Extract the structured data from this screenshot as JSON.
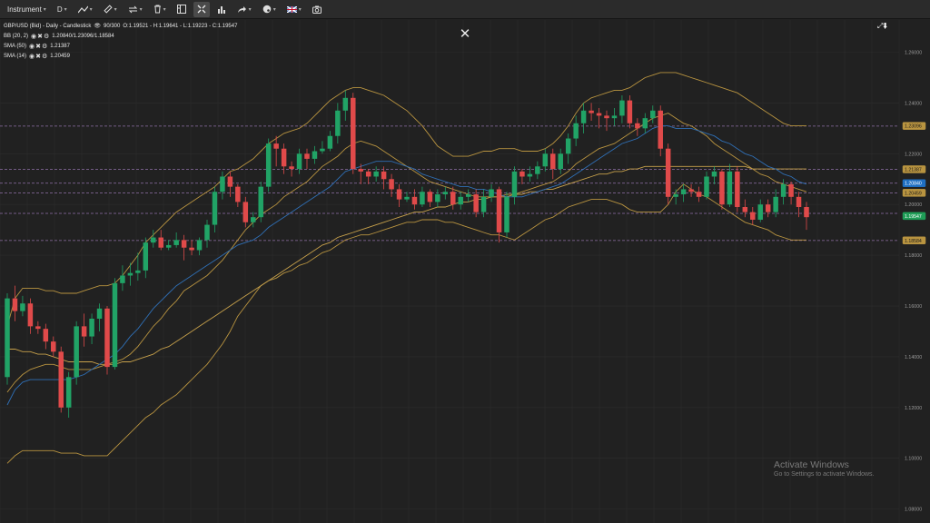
{
  "toolbar": {
    "instrument_label": "Instrument",
    "timeframe_label": "D",
    "flag_icon": "uk-flag-icon"
  },
  "legend": {
    "title_line": "GBP/USD (Bid) - Daily - Candlestick",
    "bars_info": "90/300",
    "ohlc": "O:1.19521 - H:1.19641 - L:1.19223 - C:1.19547",
    "indicators": [
      {
        "name": "BB (20, 2)",
        "values": "1.20840/1.23096/1.18584"
      },
      {
        "name": "SMA (50)",
        "values": "1.21387"
      },
      {
        "name": "SMA (14)",
        "values": "1.20459"
      }
    ]
  },
  "close_icon_glyph": "✕",
  "expand_icon_glyph": "⤢⬇",
  "colors": {
    "background": "#212121",
    "grid": "#2c2c2c",
    "bull": "#21a366",
    "bear": "#e04a4a",
    "bollinger": "#b99440",
    "sma50": "#c7a14b",
    "sma14": "#2f6fb5",
    "level_line": "#b58ad6",
    "tag_blue": "#1f6fc2",
    "tag_green": "#1f9d57"
  },
  "chart_data": {
    "type": "candlestick",
    "y_ticks": [
      "1.26000",
      "1.24000",
      "1.22000",
      "1.20000",
      "1.18000",
      "1.16000",
      "1.14000",
      "1.12000",
      "1.10000",
      "1.08000"
    ],
    "ylim": [
      1.0745,
      1.2727
    ],
    "level_lines": [
      1.2309,
      1.2139,
      1.2084,
      1.2046,
      1.1965,
      1.1858
    ],
    "price_tags": [
      {
        "text": "1.23096",
        "value": 1.23096,
        "style": "bb"
      },
      {
        "text": "1.21387",
        "value": 1.21387,
        "style": "bb"
      },
      {
        "text": "1.20840",
        "value": 1.2084,
        "style": "blue"
      },
      {
        "text": "1.20459",
        "value": 1.20459,
        "style": "bb"
      },
      {
        "text": "1.19547",
        "value": 1.19547,
        "style": "green"
      },
      {
        "text": "1.18584",
        "value": 1.18584,
        "style": "bb"
      }
    ],
    "candles": [
      [
        1.132,
        1.163,
        1.129,
        1.165
      ],
      [
        1.163,
        1.158,
        1.154,
        1.168
      ],
      [
        1.158,
        1.161,
        1.156,
        1.164
      ],
      [
        1.161,
        1.152,
        1.149,
        1.163
      ],
      [
        1.152,
        1.151,
        1.149,
        1.154
      ],
      [
        1.151,
        1.146,
        1.143,
        1.153
      ],
      [
        1.146,
        1.142,
        1.14,
        1.148
      ],
      [
        1.142,
        1.12,
        1.118,
        1.144
      ],
      [
        1.12,
        1.132,
        1.116,
        1.134
      ],
      [
        1.132,
        1.152,
        1.129,
        1.154
      ],
      [
        1.152,
        1.148,
        1.144,
        1.157
      ],
      [
        1.148,
        1.155,
        1.145,
        1.157
      ],
      [
        1.155,
        1.159,
        1.15,
        1.161
      ],
      [
        1.159,
        1.136,
        1.133,
        1.16
      ],
      [
        1.136,
        1.169,
        1.135,
        1.171
      ],
      [
        1.169,
        1.172,
        1.166,
        1.176
      ],
      [
        1.172,
        1.173,
        1.168,
        1.177
      ],
      [
        1.173,
        1.174,
        1.17,
        1.181
      ],
      [
        1.174,
        1.185,
        1.171,
        1.187
      ],
      [
        1.185,
        1.187,
        1.183,
        1.19
      ],
      [
        1.187,
        1.183,
        1.182,
        1.19
      ],
      [
        1.183,
        1.184,
        1.182,
        1.186
      ],
      [
        1.184,
        1.186,
        1.183,
        1.189
      ],
      [
        1.186,
        1.183,
        1.178,
        1.188
      ],
      [
        1.183,
        1.182,
        1.18,
        1.186
      ],
      [
        1.182,
        1.186,
        1.18,
        1.187
      ],
      [
        1.186,
        1.192,
        1.183,
        1.194
      ],
      [
        1.192,
        1.205,
        1.189,
        1.207
      ],
      [
        1.205,
        1.211,
        1.202,
        1.213
      ],
      [
        1.211,
        1.207,
        1.203,
        1.213
      ],
      [
        1.207,
        1.201,
        1.199,
        1.208
      ],
      [
        1.201,
        1.193,
        1.191,
        1.203
      ],
      [
        1.193,
        1.195,
        1.191,
        1.197
      ],
      [
        1.195,
        1.207,
        1.193,
        1.209
      ],
      [
        1.207,
        1.224,
        1.205,
        1.226
      ],
      [
        1.224,
        1.222,
        1.215,
        1.227
      ],
      [
        1.222,
        1.215,
        1.212,
        1.224
      ],
      [
        1.215,
        1.214,
        1.211,
        1.217
      ],
      [
        1.214,
        1.22,
        1.212,
        1.222
      ],
      [
        1.22,
        1.218,
        1.214,
        1.222
      ],
      [
        1.218,
        1.221,
        1.216,
        1.223
      ],
      [
        1.221,
        1.222,
        1.22,
        1.225
      ],
      [
        1.222,
        1.227,
        1.221,
        1.229
      ],
      [
        1.227,
        1.237,
        1.224,
        1.24
      ],
      [
        1.237,
        1.242,
        1.233,
        1.245
      ],
      [
        1.242,
        1.214,
        1.212,
        1.244
      ],
      [
        1.214,
        1.213,
        1.208,
        1.216
      ],
      [
        1.213,
        1.211,
        1.208,
        1.214
      ],
      [
        1.211,
        1.213,
        1.209,
        1.215
      ],
      [
        1.213,
        1.21,
        1.206,
        1.215
      ],
      [
        1.21,
        1.206,
        1.203,
        1.212
      ],
      [
        1.206,
        1.202,
        1.199,
        1.208
      ],
      [
        1.202,
        1.203,
        1.201,
        1.205
      ],
      [
        1.203,
        1.2,
        1.198,
        1.206
      ],
      [
        1.2,
        1.205,
        1.199,
        1.207
      ],
      [
        1.205,
        1.201,
        1.199,
        1.206
      ],
      [
        1.201,
        1.204,
        1.199,
        1.206
      ],
      [
        1.204,
        1.205,
        1.202,
        1.207
      ],
      [
        1.205,
        1.2,
        1.198,
        1.207
      ],
      [
        1.2,
        1.203,
        1.198,
        1.205
      ],
      [
        1.203,
        1.204,
        1.201,
        1.206
      ],
      [
        1.204,
        1.197,
        1.195,
        1.206
      ],
      [
        1.197,
        1.203,
        1.195,
        1.206
      ],
      [
        1.203,
        1.206,
        1.201,
        1.208
      ],
      [
        1.206,
        1.189,
        1.185,
        1.207
      ],
      [
        1.189,
        1.203,
        1.187,
        1.205
      ],
      [
        1.203,
        1.213,
        1.2,
        1.215
      ],
      [
        1.213,
        1.211,
        1.208,
        1.214
      ],
      [
        1.211,
        1.212,
        1.209,
        1.215
      ],
      [
        1.212,
        1.215,
        1.21,
        1.217
      ],
      [
        1.215,
        1.22,
        1.213,
        1.222
      ],
      [
        1.22,
        1.214,
        1.21,
        1.222
      ],
      [
        1.214,
        1.22,
        1.212,
        1.222
      ],
      [
        1.22,
        1.226,
        1.216,
        1.228
      ],
      [
        1.226,
        1.232,
        1.223,
        1.235
      ],
      [
        1.232,
        1.237,
        1.228,
        1.24
      ],
      [
        1.237,
        1.236,
        1.233,
        1.24
      ],
      [
        1.236,
        1.235,
        1.23,
        1.238
      ],
      [
        1.235,
        1.234,
        1.229,
        1.237
      ],
      [
        1.234,
        1.235,
        1.231,
        1.238
      ],
      [
        1.235,
        1.241,
        1.232,
        1.243
      ],
      [
        1.241,
        1.232,
        1.23,
        1.243
      ],
      [
        1.232,
        1.23,
        1.227,
        1.234
      ],
      [
        1.23,
        1.234,
        1.228,
        1.236
      ],
      [
        1.234,
        1.237,
        1.232,
        1.239
      ],
      [
        1.237,
        1.222,
        1.219,
        1.239
      ],
      [
        1.222,
        1.203,
        1.2,
        1.224
      ],
      [
        1.203,
        1.204,
        1.2,
        1.206
      ],
      [
        1.204,
        1.206,
        1.201,
        1.208
      ],
      [
        1.206,
        1.205,
        1.203,
        1.208
      ],
      [
        1.205,
        1.203,
        1.201,
        1.207
      ],
      [
        1.203,
        1.211,
        1.202,
        1.213
      ],
      [
        1.211,
        1.213,
        1.208,
        1.215
      ],
      [
        1.213,
        1.2,
        1.198,
        1.214
      ],
      [
        1.2,
        1.213,
        1.199,
        1.216
      ],
      [
        1.213,
        1.199,
        1.197,
        1.215
      ],
      [
        1.199,
        1.197,
        1.195,
        1.202
      ],
      [
        1.197,
        1.194,
        1.192,
        1.199
      ],
      [
        1.194,
        1.2,
        1.193,
        1.202
      ],
      [
        1.2,
        1.197,
        1.195,
        1.202
      ],
      [
        1.197,
        1.203,
        1.195,
        1.206
      ],
      [
        1.203,
        1.208,
        1.2,
        1.21
      ],
      [
        1.208,
        1.203,
        1.2,
        1.209
      ],
      [
        1.203,
        1.199,
        1.195,
        1.205
      ],
      [
        1.199,
        1.195,
        1.19,
        1.201
      ]
    ],
    "sma14": [
      1.121,
      1.127,
      1.13,
      1.131,
      1.131,
      1.131,
      1.131,
      1.131,
      1.131,
      1.132,
      1.133,
      1.135,
      1.137,
      1.139,
      1.141,
      1.144,
      1.148,
      1.151,
      1.155,
      1.159,
      1.162,
      1.165,
      1.168,
      1.17,
      1.172,
      1.174,
      1.176,
      1.178,
      1.18,
      1.182,
      1.184,
      1.185,
      1.186,
      1.188,
      1.191,
      1.193,
      1.195,
      1.197,
      1.199,
      1.201,
      1.203,
      1.205,
      1.207,
      1.21,
      1.213,
      1.214,
      1.215,
      1.216,
      1.217,
      1.217,
      1.217,
      1.216,
      1.215,
      1.214,
      1.212,
      1.211,
      1.21,
      1.209,
      1.208,
      1.207,
      1.207,
      1.206,
      1.206,
      1.205,
      1.204,
      1.203,
      1.203,
      1.203,
      1.204,
      1.205,
      1.206,
      1.207,
      1.208,
      1.21,
      1.212,
      1.214,
      1.216,
      1.218,
      1.22,
      1.222,
      1.224,
      1.225,
      1.226,
      1.228,
      1.23,
      1.231,
      1.231,
      1.23,
      1.23,
      1.23,
      1.229,
      1.228,
      1.227,
      1.225,
      1.224,
      1.222,
      1.22,
      1.219,
      1.217,
      1.215,
      1.214,
      1.212,
      1.211,
      1.209,
      1.208
    ],
    "sma50": [
      1.143,
      1.143,
      1.142,
      1.142,
      1.141,
      1.141,
      1.14,
      1.139,
      1.138,
      1.138,
      1.138,
      1.138,
      1.137,
      1.137,
      1.137,
      1.138,
      1.138,
      1.139,
      1.14,
      1.141,
      1.143,
      1.144,
      1.146,
      1.148,
      1.15,
      1.152,
      1.154,
      1.156,
      1.158,
      1.16,
      1.162,
      1.164,
      1.166,
      1.168,
      1.17,
      1.172,
      1.174,
      1.176,
      1.178,
      1.18,
      1.182,
      1.184,
      1.185,
      1.187,
      1.188,
      1.189,
      1.19,
      1.191,
      1.192,
      1.193,
      1.194,
      1.195,
      1.196,
      1.197,
      1.197,
      1.198,
      1.199,
      1.199,
      1.2,
      1.201,
      1.201,
      1.202,
      1.202,
      1.203,
      1.203,
      1.203,
      1.204,
      1.204,
      1.205,
      1.205,
      1.206,
      1.206,
      1.207,
      1.208,
      1.209,
      1.21,
      1.211,
      1.212,
      1.212,
      1.213,
      1.213,
      1.214,
      1.214,
      1.215,
      1.215,
      1.215,
      1.215,
      1.215,
      1.215,
      1.215,
      1.215,
      1.215,
      1.215,
      1.215,
      1.215,
      1.215,
      1.215,
      1.214,
      1.214,
      1.214,
      1.214,
      1.214,
      1.214,
      1.214,
      1.214
    ],
    "bb_upper": [
      1.152,
      1.163,
      1.167,
      1.167,
      1.167,
      1.166,
      1.166,
      1.165,
      1.165,
      1.165,
      1.166,
      1.167,
      1.168,
      1.168,
      1.169,
      1.172,
      1.176,
      1.18,
      1.185,
      1.188,
      1.191,
      1.194,
      1.197,
      1.199,
      1.201,
      1.203,
      1.205,
      1.207,
      1.21,
      1.213,
      1.214,
      1.216,
      1.218,
      1.221,
      1.224,
      1.226,
      1.228,
      1.229,
      1.23,
      1.232,
      1.235,
      1.238,
      1.241,
      1.243,
      1.245,
      1.246,
      1.246,
      1.245,
      1.244,
      1.243,
      1.241,
      1.239,
      1.237,
      1.234,
      1.231,
      1.227,
      1.223,
      1.221,
      1.219,
      1.219,
      1.219,
      1.22,
      1.221,
      1.221,
      1.222,
      1.222,
      1.222,
      1.221,
      1.221,
      1.221,
      1.222,
      1.224,
      1.227,
      1.231,
      1.236,
      1.24,
      1.242,
      1.243,
      1.244,
      1.245,
      1.245,
      1.246,
      1.248,
      1.25,
      1.251,
      1.252,
      1.252,
      1.252,
      1.251,
      1.25,
      1.249,
      1.248,
      1.247,
      1.246,
      1.245,
      1.244,
      1.242,
      1.24,
      1.238,
      1.236,
      1.234,
      1.232,
      1.231,
      1.231,
      1.231
    ],
    "bb_lower": [
      1.098,
      1.101,
      1.103,
      1.103,
      1.103,
      1.103,
      1.103,
      1.102,
      1.102,
      1.102,
      1.101,
      1.101,
      1.101,
      1.101,
      1.104,
      1.107,
      1.11,
      1.113,
      1.116,
      1.118,
      1.121,
      1.123,
      1.125,
      1.128,
      1.131,
      1.134,
      1.137,
      1.141,
      1.145,
      1.15,
      1.156,
      1.16,
      1.164,
      1.168,
      1.17,
      1.171,
      1.173,
      1.174,
      1.176,
      1.177,
      1.179,
      1.181,
      1.182,
      1.184,
      1.186,
      1.187,
      1.188,
      1.188,
      1.189,
      1.19,
      1.191,
      1.192,
      1.193,
      1.193,
      1.194,
      1.194,
      1.194,
      1.193,
      1.193,
      1.192,
      1.191,
      1.19,
      1.189,
      1.188,
      1.188,
      1.187,
      1.186,
      1.188,
      1.19,
      1.192,
      1.194,
      1.195,
      1.197,
      1.199,
      1.2,
      1.201,
      1.202,
      1.202,
      1.202,
      1.201,
      1.2,
      1.198,
      1.197,
      1.197,
      1.197,
      1.197,
      1.2,
      1.205,
      1.208,
      1.206,
      1.204,
      1.203,
      1.201,
      1.199,
      1.197,
      1.195,
      1.193,
      1.192,
      1.191,
      1.19,
      1.188,
      1.187,
      1.186,
      1.186,
      1.186
    ],
    "bb_mid": [
      1.126,
      1.13,
      1.133,
      1.135,
      1.136,
      1.137,
      1.137,
      1.136,
      1.135,
      1.135,
      1.135,
      1.135,
      1.136,
      1.137,
      1.138,
      1.139,
      1.141,
      1.144,
      1.148,
      1.152,
      1.155,
      1.159,
      1.162,
      1.166,
      1.168,
      1.17,
      1.172,
      1.175,
      1.178,
      1.182,
      1.186,
      1.19,
      1.193,
      1.196,
      1.198,
      1.2,
      1.203,
      1.205,
      1.207,
      1.209,
      1.212,
      1.215,
      1.217,
      1.219,
      1.222,
      1.224,
      1.225,
      1.224,
      1.223,
      1.221,
      1.219,
      1.217,
      1.215,
      1.213,
      1.211,
      1.209,
      1.208,
      1.207,
      1.206,
      1.205,
      1.204,
      1.203,
      1.203,
      1.203,
      1.203,
      1.204,
      1.204,
      1.205,
      1.206,
      1.207,
      1.208,
      1.209,
      1.211,
      1.213,
      1.216,
      1.218,
      1.22,
      1.222,
      1.223,
      1.224,
      1.226,
      1.228,
      1.23,
      1.232,
      1.234,
      1.235,
      1.236,
      1.234,
      1.232,
      1.231,
      1.229,
      1.227,
      1.224,
      1.222,
      1.22,
      1.218,
      1.216,
      1.214,
      1.212,
      1.211,
      1.209,
      1.208,
      1.207,
      1.206,
      1.205
    ]
  },
  "watermark": {
    "title": "Activate Windows",
    "subtitle": "Go to Settings to activate Windows."
  }
}
